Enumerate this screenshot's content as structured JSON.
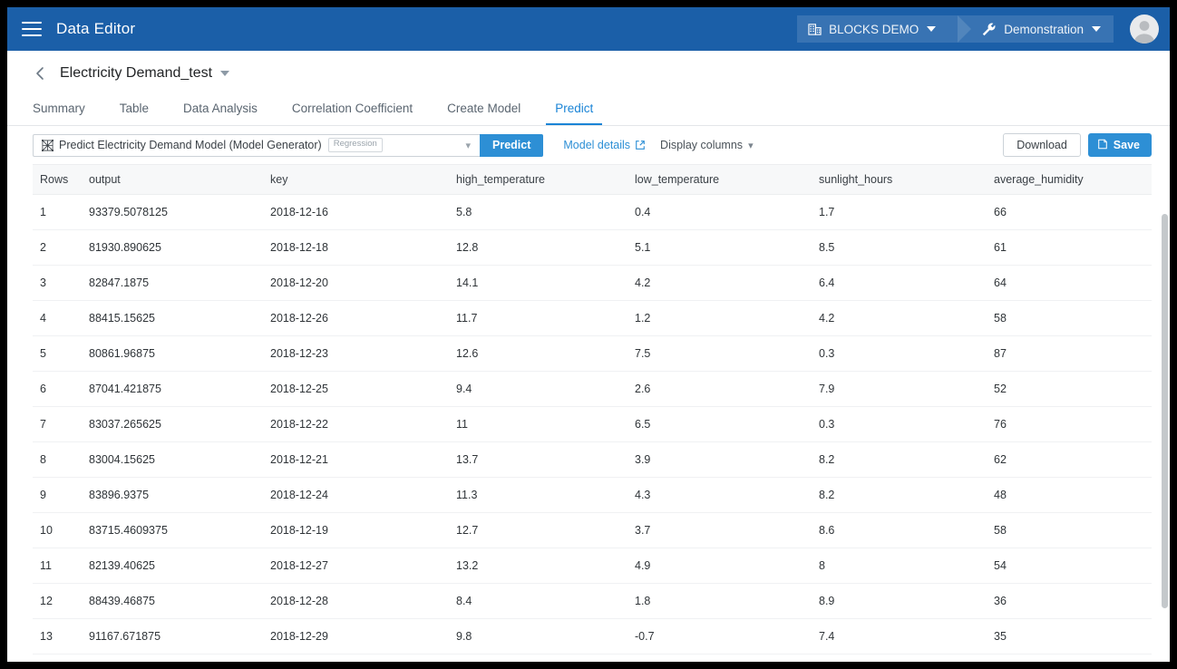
{
  "topbar": {
    "menu_icon": "hamburger-icon",
    "app_title": "Data Editor",
    "workspace": {
      "label": "BLOCKS DEMO",
      "icon": "building-icon"
    },
    "environment": {
      "label": "Demonstration",
      "icon": "wrench-icon"
    },
    "avatar": "user-avatar"
  },
  "page": {
    "back_icon": "chevron-left-icon",
    "title": "Electricity Demand_test",
    "title_caret": "caret-down-icon"
  },
  "tabs": [
    {
      "label": "Summary",
      "active": false
    },
    {
      "label": "Table",
      "active": false
    },
    {
      "label": "Data Analysis",
      "active": false
    },
    {
      "label": "Correlation Coefficient",
      "active": false
    },
    {
      "label": "Create Model",
      "active": false
    },
    {
      "label": "Predict",
      "active": true
    }
  ],
  "toolbar": {
    "model_icon": "model-mesh-icon",
    "model_name": "Predict Electricity Demand Model (Model Generator)",
    "model_badge": "Regression",
    "select_chevron": "chevron-down-icon",
    "predict_label": "Predict",
    "model_details_label": "Model details",
    "model_details_icon": "external-link-icon",
    "display_columns_label": "Display columns",
    "display_columns_chevron": "chevron-down-icon",
    "download_label": "Download",
    "save_label": "Save",
    "save_icon": "save-document-icon"
  },
  "table": {
    "columns": [
      "Rows",
      "output",
      "key",
      "high_temperature",
      "low_temperature",
      "sunlight_hours",
      "average_humidity"
    ],
    "rows": [
      [
        "1",
        "93379.5078125",
        "2018-12-16",
        "5.8",
        "0.4",
        "1.7",
        "66"
      ],
      [
        "2",
        "81930.890625",
        "2018-12-18",
        "12.8",
        "5.1",
        "8.5",
        "61"
      ],
      [
        "3",
        "82847.1875",
        "2018-12-20",
        "14.1",
        "4.2",
        "6.4",
        "64"
      ],
      [
        "4",
        "88415.15625",
        "2018-12-26",
        "11.7",
        "1.2",
        "4.2",
        "58"
      ],
      [
        "5",
        "80861.96875",
        "2018-12-23",
        "12.6",
        "7.5",
        "0.3",
        "87"
      ],
      [
        "6",
        "87041.421875",
        "2018-12-25",
        "9.4",
        "2.6",
        "7.9",
        "52"
      ],
      [
        "7",
        "83037.265625",
        "2018-12-22",
        "11",
        "6.5",
        "0.3",
        "76"
      ],
      [
        "8",
        "83004.15625",
        "2018-12-21",
        "13.7",
        "3.9",
        "8.2",
        "62"
      ],
      [
        "9",
        "83896.9375",
        "2018-12-24",
        "11.3",
        "4.3",
        "8.2",
        "48"
      ],
      [
        "10",
        "83715.4609375",
        "2018-12-19",
        "12.7",
        "3.7",
        "8.6",
        "58"
      ],
      [
        "11",
        "82139.40625",
        "2018-12-27",
        "13.2",
        "4.9",
        "8",
        "54"
      ],
      [
        "12",
        "88439.46875",
        "2018-12-28",
        "8.4",
        "1.8",
        "8.9",
        "36"
      ],
      [
        "13",
        "91167.671875",
        "2018-12-29",
        "9.8",
        "-0.7",
        "7.4",
        "35"
      ]
    ]
  },
  "colors": {
    "topbar_blue": "#1b5fa8",
    "accent_blue": "#2d8fd5",
    "tab_active": "#1a84d6"
  }
}
